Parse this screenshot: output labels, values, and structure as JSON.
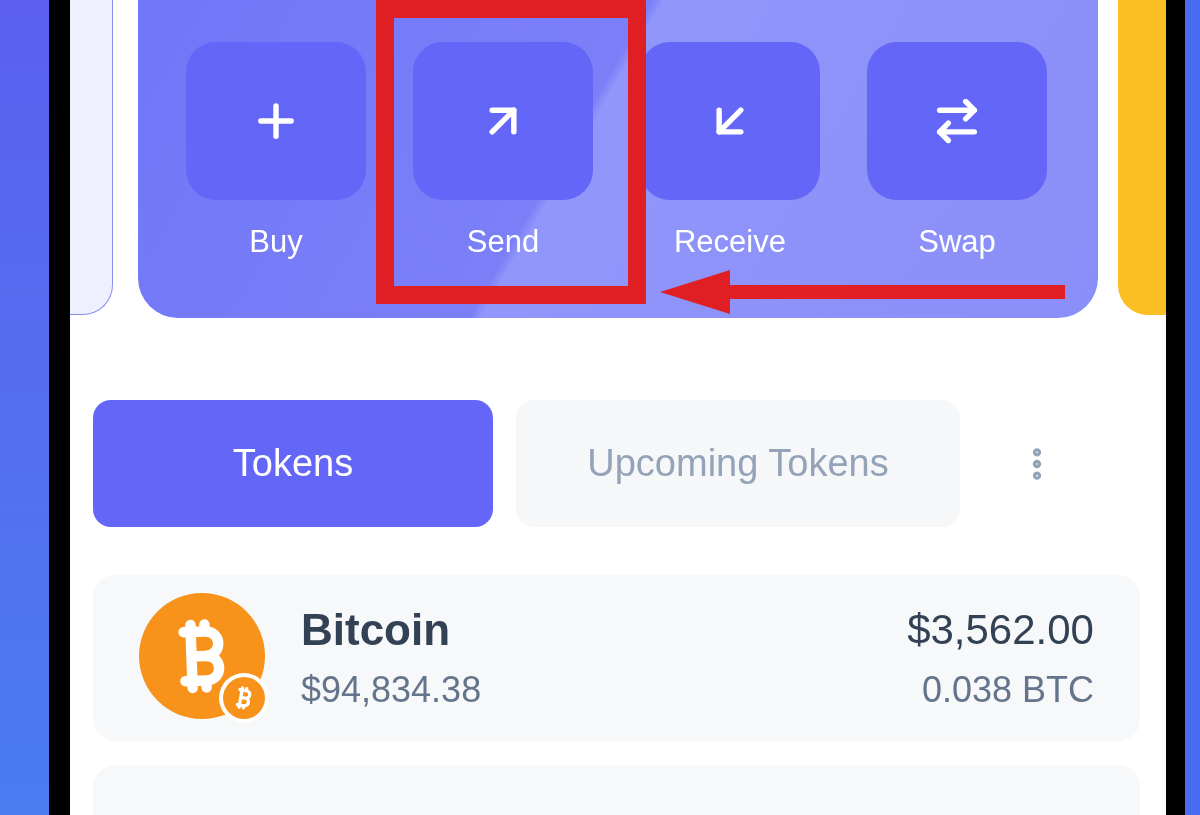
{
  "actions": [
    {
      "kind": "buy",
      "label": "Buy"
    },
    {
      "kind": "send",
      "label": "Send"
    },
    {
      "kind": "receive",
      "label": "Receive"
    },
    {
      "kind": "swap",
      "label": "Swap"
    }
  ],
  "tabs": [
    {
      "label": "Tokens",
      "selected": true
    },
    {
      "label": "Upcoming Tokens",
      "selected": false
    }
  ],
  "tokens": [
    {
      "name": "Bitcoin",
      "price": "$94,834.38",
      "value": "$3,562.00",
      "amount": "0.038 BTC"
    }
  ]
}
